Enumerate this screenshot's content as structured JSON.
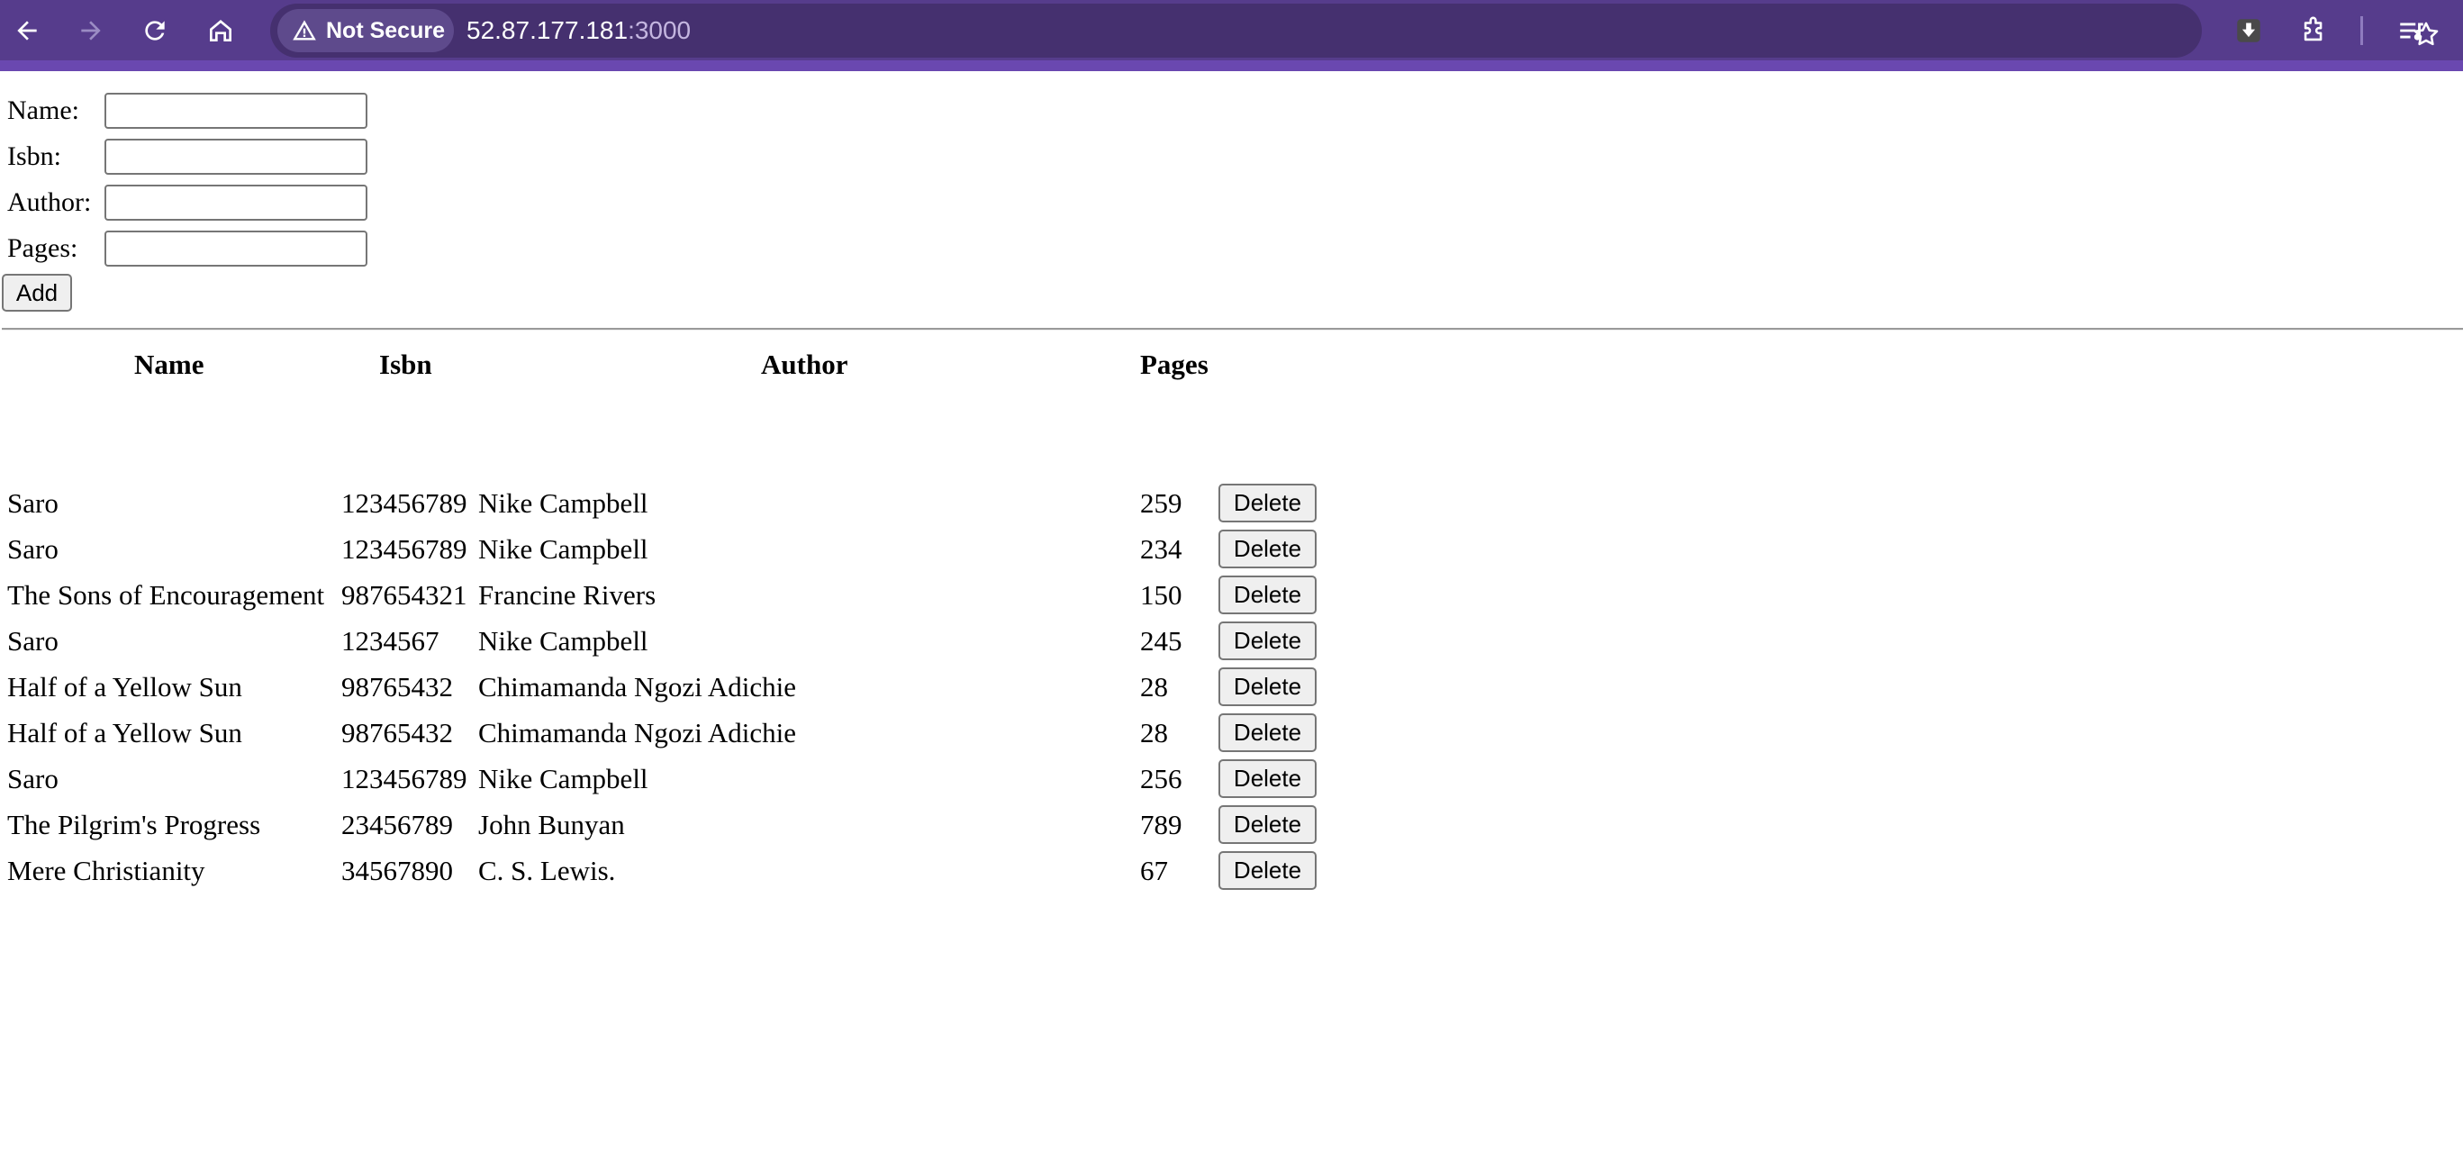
{
  "browser": {
    "security_label": "Not Secure",
    "url_host": "52.87.177.181",
    "url_port": ":3000"
  },
  "form": {
    "name_label": "Name:",
    "isbn_label": "Isbn:",
    "author_label": "Author:",
    "pages_label": "Pages:",
    "name_value": "",
    "isbn_value": "",
    "author_value": "",
    "pages_value": "",
    "add_label": "Add"
  },
  "table": {
    "headers": {
      "name": "Name",
      "isbn": "Isbn",
      "author": "Author",
      "pages": "Pages"
    },
    "delete_label": "Delete",
    "rows": [
      {
        "name": "Saro",
        "isbn": "123456789",
        "author": "Nike Campbell",
        "pages": "259"
      },
      {
        "name": "Saro",
        "isbn": "123456789",
        "author": "Nike Campbell",
        "pages": "234"
      },
      {
        "name": "The Sons of Encouragement",
        "isbn": "987654321",
        "author": "Francine Rivers",
        "pages": "150"
      },
      {
        "name": "Saro",
        "isbn": "1234567",
        "author": "Nike Campbell",
        "pages": "245"
      },
      {
        "name": "Half of a Yellow Sun",
        "isbn": "98765432",
        "author": "Chimamanda Ngozi Adichie",
        "pages": "28"
      },
      {
        "name": "Half of a Yellow Sun",
        "isbn": "98765432",
        "author": "Chimamanda Ngozi Adichie",
        "pages": "28"
      },
      {
        "name": "Saro",
        "isbn": "123456789",
        "author": "Nike Campbell",
        "pages": "256"
      },
      {
        "name": "The Pilgrim's Progress",
        "isbn": "23456789",
        "author": "John Bunyan",
        "pages": "789"
      },
      {
        "name": "Mere Christianity",
        "isbn": "34567890",
        "author": "C. S. Lewis.",
        "pages": "67"
      }
    ]
  },
  "colors": {
    "toolbar": "#563c8c",
    "omnibox": "#45306f"
  }
}
